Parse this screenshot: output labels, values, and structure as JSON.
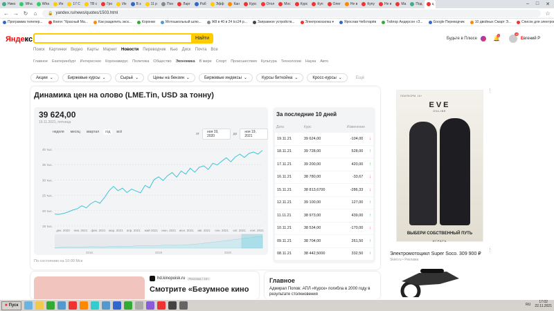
{
  "tabs": [
    {
      "label": "Нико",
      "color": "#4a8"
    },
    {
      "label": "Wha",
      "color": "#3c6"
    },
    {
      "label": "Wha",
      "color": "#3c6"
    },
    {
      "label": "Ин",
      "color": "#fc0"
    },
    {
      "label": "17 С",
      "color": "#fc0"
    },
    {
      "label": "ТВ с",
      "color": "#fc0"
    },
    {
      "label": "Гро",
      "color": "#e33"
    },
    {
      "label": "Ин",
      "color": "#fc0"
    },
    {
      "label": "В з",
      "color": "#36c"
    },
    {
      "label": "11 р",
      "color": "#fc0"
    },
    {
      "label": "Пон",
      "color": "#888"
    },
    {
      "label": "Ларг",
      "color": "#e33"
    },
    {
      "label": "Раб",
      "color": "#36c"
    },
    {
      "label": "Эфф",
      "color": "#fc0"
    },
    {
      "label": "Кан",
      "color": "#f80"
    },
    {
      "label": "Курс",
      "color": "#e33"
    },
    {
      "label": "Отол",
      "color": "#f33"
    },
    {
      "label": "Мос",
      "color": "#e33"
    },
    {
      "label": "Курс",
      "color": "#e33"
    },
    {
      "label": "Куп",
      "color": "#e33"
    },
    {
      "label": "Олег",
      "color": "#e33"
    },
    {
      "label": "Не в",
      "color": "#f80"
    },
    {
      "label": "Купу",
      "color": "#e33"
    },
    {
      "label": "Не в",
      "color": "#e33"
    },
    {
      "label": "Ма",
      "color": "#e33"
    },
    {
      "label": "Под",
      "color": "#4a8"
    },
    {
      "label": "ц",
      "color": "#e33",
      "active": true
    }
  ],
  "addr": {
    "url": "yandex.ru/news/quotes/1503.html",
    "lock": "🔒"
  },
  "bookmarks": [
    "Программа телепер...",
    "Книги: \"Красный Ма...",
    "Как разделить экск...",
    "Коронки",
    "Мотошкольный шлю...",
    "Ж8 в 40 в 24 tcc24 р...",
    "Заправное устройств...",
    "Электрокосилка ▾",
    "Ярослав Чеботарёв",
    "Тейлор Андерсон «З...",
    "Google Переводчик",
    "10 двойных Смарт Э...",
    "Список для электров..."
  ],
  "header": {
    "logo_main": "Янде",
    "logo_tail": "кс",
    "find": "Найти",
    "plus": "Будьте в Плюсе",
    "bell_badge": "1",
    "avatar_badge": "10",
    "user_first": "Е",
    "user_rest": "вгений Р"
  },
  "services": [
    {
      "label": "Поиск"
    },
    {
      "label": "Картинки"
    },
    {
      "label": "Видео"
    },
    {
      "label": "Карты"
    },
    {
      "label": "Маркет"
    },
    {
      "label": "Новости",
      "active": true
    },
    {
      "label": "Переводчик"
    },
    {
      "label": "Кью"
    },
    {
      "label": "Диск"
    },
    {
      "label": "Почта"
    },
    {
      "label": "Все"
    }
  ],
  "categories": [
    {
      "label": "Главное"
    },
    {
      "label": "Екатеринбург"
    },
    {
      "label": "Интересное"
    },
    {
      "label": "Коронавирус"
    },
    {
      "label": "Политика"
    },
    {
      "label": "Общество"
    },
    {
      "label": "Экономика",
      "active": true
    },
    {
      "label": "В мире"
    },
    {
      "label": "Спорт"
    },
    {
      "label": "Происшествия"
    },
    {
      "label": "Культура"
    },
    {
      "label": "Технологии"
    },
    {
      "label": "Наука"
    },
    {
      "label": "Авто"
    }
  ],
  "chips": [
    {
      "label": "Акции",
      "dd": "⌄"
    },
    {
      "label": "Биржевые курсы",
      "dd": "⌄"
    },
    {
      "label": "Сырьё",
      "dd": "⌄"
    },
    {
      "label": "Цены на бензин",
      "dd": "⌄"
    },
    {
      "label": "Биржевые индексы",
      "dd": "⌄"
    },
    {
      "label": "Курсы биткойна",
      "dd": "⌄"
    },
    {
      "label": "Кросс-курсы",
      "dd": "⌄"
    },
    {
      "label": "Ещё",
      "dd": "",
      "plain": true
    }
  ],
  "main": {
    "title": "Динамика цен на олово (LME.Tin, USD за тонну)",
    "price": "39 624,00",
    "price_date": "19.11.2021, пятница",
    "periods": [
      {
        "label": "неделя"
      },
      {
        "label": "месяц"
      },
      {
        "label": "квартал"
      },
      {
        "label": "год",
        "active": true
      },
      {
        "label": "всё"
      }
    ],
    "from_label": "от",
    "from": "ноя 19, 2020",
    "to_label": "до",
    "to": "ноя 19, 2021",
    "footnote": "По состоянию на 10:00 Мск"
  },
  "chart_data": {
    "type": "line",
    "ylim": [
      15000,
      42000
    ],
    "y_ticks": [
      {
        "v": 15000,
        "label": "15 тыс."
      },
      {
        "v": 20000,
        "label": "20 тыс."
      },
      {
        "v": 25000,
        "label": "25 тыс."
      },
      {
        "v": 30000,
        "label": "30 тыс."
      },
      {
        "v": 35000,
        "label": "35 тыс."
      },
      {
        "v": 40000,
        "label": "40 тыс."
      }
    ],
    "x_ticks": [
      "дек. 2020",
      "янв. 2021",
      "фев. 2021",
      "мар. 2021",
      "апр. 2021",
      "май 2021",
      "июн. 2021",
      "июл. 2021",
      "авг. 2021",
      "сен. 2021",
      "окт. 2021",
      "ноя. 2021"
    ],
    "nav_ticks": [
      "2015",
      "2018",
      "2020"
    ],
    "line_color": "#3cc4d9",
    "values": [
      18900,
      18800,
      19100,
      19600,
      20200,
      20600,
      21600,
      20900,
      22300,
      23100,
      22400,
      24200,
      26400,
      27900,
      26500,
      27300,
      25900,
      27000,
      26400,
      25800,
      28200,
      27400,
      30100,
      31000,
      29800,
      31400,
      32400,
      30900,
      32900,
      31900,
      33800,
      32500,
      34100,
      34600,
      33400,
      35400,
      34900,
      36100,
      37200,
      35900,
      37500,
      38400,
      37300,
      38600,
      39100,
      38400,
      39624
    ]
  },
  "table": {
    "title": "За последние 10 дней",
    "cols": [
      "Дата",
      "Курс",
      "Изменение"
    ],
    "rows": [
      {
        "date": "19.11.21",
        "rate": "39 624,00",
        "change": "-104,00",
        "dir": "down"
      },
      {
        "date": "18.11.21",
        "rate": "39 728,00",
        "change": "528,00",
        "dir": "up"
      },
      {
        "date": "17.11.21",
        "rate": "39 200,00",
        "change": "420,00",
        "dir": "up"
      },
      {
        "date": "16.11.21",
        "rate": "38 780,00",
        "change": "-33,67",
        "dir": "down"
      },
      {
        "date": "15.11.21",
        "rate": "38 813,6700",
        "change": "-286,33",
        "dir": "down"
      },
      {
        "date": "12.11.21",
        "rate": "39 100,00",
        "change": "127,00",
        "dir": "up"
      },
      {
        "date": "11.11.21",
        "rate": "38 973,00",
        "change": "439,00",
        "dir": "up"
      },
      {
        "date": "10.11.21",
        "rate": "38 534,00",
        "change": "-170,00",
        "dir": "down"
      },
      {
        "date": "09.11.21",
        "rate": "38 704,00",
        "change": "261,50",
        "dir": "up"
      },
      {
        "date": "08.11.21",
        "rate": "38 442,5000",
        "change": "332,50",
        "dir": "up"
      }
    ]
  },
  "ad1": {
    "badge": "ПЛАТФОРМ. 16+",
    "logo": "EVE",
    "logo_sub": "ONLINE",
    "tagline": "ВЫБЕРИ СОБСТВЕННЫЙ ПУТЬ",
    "play": "ИГРАТЬ",
    "dots": "⋮"
  },
  "ad2": {
    "title": "Электромотоцикл Super Soco. 309 900 ₽",
    "sub": "Skiel.ru • Реклама",
    "dots": "⋮"
  },
  "news1": {
    "source": "hd.kinopoisk.ru",
    "badge": "Реклама / 18+",
    "headline": "Смотрите «Безумное кино"
  },
  "news2": {
    "title": "Главное",
    "text": "Адмирал Попов: АПЛ «Курск» погибла в 2000 году в результате столкновения"
  },
  "taskbar": {
    "start": "Пуск",
    "lang": "RU",
    "time": "17:02",
    "date": "22.11.2021",
    "icons": [
      "#6bb3e0",
      "#f2c94c",
      "#3a3",
      "#59c",
      "#e33",
      "#f80",
      "#3cc",
      "#59c",
      "#36c",
      "#3a3",
      "#aaa",
      "#8a5bd6",
      "#e33",
      "#444",
      "#666"
    ]
  },
  "icons": {
    "back": "←",
    "forward": "→",
    "reload": "↻",
    "home": "⌂",
    "star": "☆",
    "bell": "🔔",
    "arrow_up": "↑",
    "arrow_down": "↓",
    "minimize": "–",
    "maximize": "□",
    "close": "✕"
  }
}
